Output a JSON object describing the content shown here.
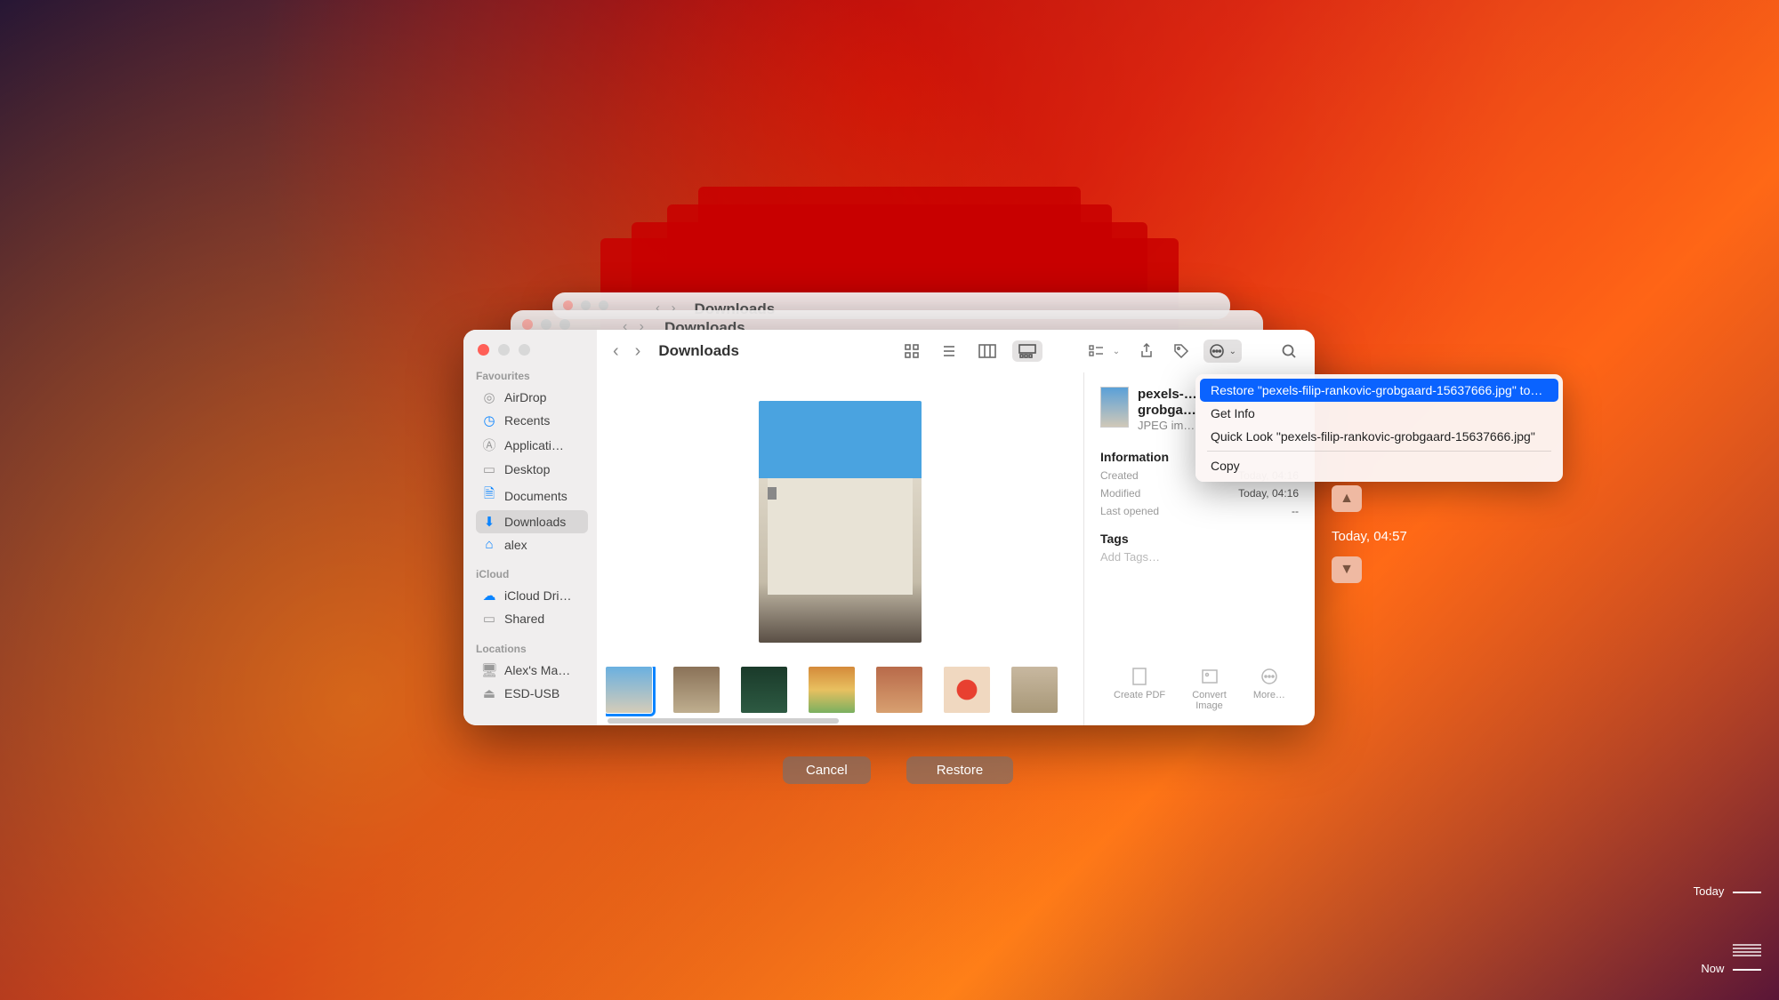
{
  "toolbar": {
    "title": "Downloads",
    "back_title3": "Downloads",
    "back_title2": "Downloads"
  },
  "sidebar": {
    "sections": {
      "favourites": "Favourites",
      "icloud": "iCloud",
      "locations": "Locations"
    },
    "items": {
      "airdrop": "AirDrop",
      "recents": "Recents",
      "applications": "Applicati…",
      "desktop": "Desktop",
      "documents": "Documents",
      "downloads": "Downloads",
      "alex": "alex",
      "iclouddrive": "iCloud Dri…",
      "shared": "Shared",
      "alexsmac": "Alex's Ma…",
      "esdusb": "ESD-USB"
    }
  },
  "info": {
    "name_line1": "pexels-…",
    "name_line2": "grobga…",
    "kind": "JPEG im…",
    "section_info": "Information",
    "created_k": "Created",
    "created_v": "Today, 04:16",
    "modified_k": "Modified",
    "modified_v": "Today, 04:16",
    "lastopen_k": "Last opened",
    "lastopen_v": "--",
    "tags_h": "Tags",
    "addtags": "Add Tags…",
    "actions": {
      "pdf": "Create PDF",
      "convert1": "Convert",
      "convert2": "Image",
      "more": "More…"
    }
  },
  "context_menu": {
    "restore": "Restore \"pexels-filip-rankovic-grobgaard-15637666.jpg\" to…",
    "getinfo": "Get Info",
    "quicklook": "Quick Look \"pexels-filip-rankovic-grobgaard-15637666.jpg\"",
    "copy": "Copy"
  },
  "tm": {
    "cancel": "Cancel",
    "restore": "Restore",
    "snapshot_time": "Today, 04:57",
    "timeline_today": "Today",
    "timeline_now": "Now"
  }
}
